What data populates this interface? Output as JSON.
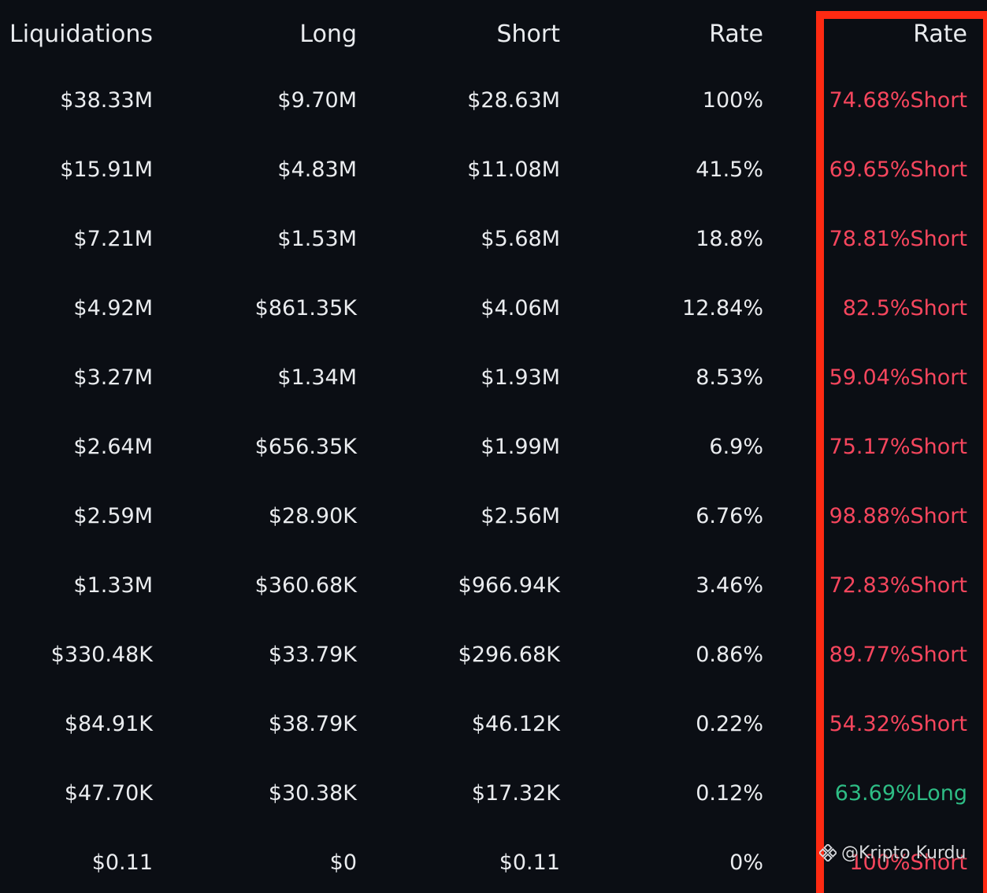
{
  "table": {
    "headers": [
      "Liquidations",
      "Long",
      "Short",
      "Rate",
      "Rate"
    ],
    "rows": [
      {
        "liquidations": "$38.33M",
        "long": "$9.70M",
        "short": "$28.63M",
        "rate": "100%",
        "side_rate": "74.68%Short",
        "side": "short"
      },
      {
        "liquidations": "$15.91M",
        "long": "$4.83M",
        "short": "$11.08M",
        "rate": "41.5%",
        "side_rate": "69.65%Short",
        "side": "short"
      },
      {
        "liquidations": "$7.21M",
        "long": "$1.53M",
        "short": "$5.68M",
        "rate": "18.8%",
        "side_rate": "78.81%Short",
        "side": "short"
      },
      {
        "liquidations": "$4.92M",
        "long": "$861.35K",
        "short": "$4.06M",
        "rate": "12.84%",
        "side_rate": "82.5%Short",
        "side": "short"
      },
      {
        "liquidations": "$3.27M",
        "long": "$1.34M",
        "short": "$1.93M",
        "rate": "8.53%",
        "side_rate": "59.04%Short",
        "side": "short"
      },
      {
        "liquidations": "$2.64M",
        "long": "$656.35K",
        "short": "$1.99M",
        "rate": "6.9%",
        "side_rate": "75.17%Short",
        "side": "short"
      },
      {
        "liquidations": "$2.59M",
        "long": "$28.90K",
        "short": "$2.56M",
        "rate": "6.76%",
        "side_rate": "98.88%Short",
        "side": "short"
      },
      {
        "liquidations": "$1.33M",
        "long": "$360.68K",
        "short": "$966.94K",
        "rate": "3.46%",
        "side_rate": "72.83%Short",
        "side": "short"
      },
      {
        "liquidations": "$330.48K",
        "long": "$33.79K",
        "short": "$296.68K",
        "rate": "0.86%",
        "side_rate": "89.77%Short",
        "side": "short"
      },
      {
        "liquidations": "$84.91K",
        "long": "$38.79K",
        "short": "$46.12K",
        "rate": "0.22%",
        "side_rate": "54.32%Short",
        "side": "short"
      },
      {
        "liquidations": "$47.70K",
        "long": "$30.38K",
        "short": "$17.32K",
        "rate": "0.12%",
        "side_rate": "63.69%Long",
        "side": "long"
      },
      {
        "liquidations": "$0.11",
        "long": "$0",
        "short": "$0.11",
        "rate": "0%",
        "side_rate": "100%Short",
        "side": "short"
      }
    ]
  },
  "colors": {
    "background": "#0b0e14",
    "text": "#eaecef",
    "short": "#f6465d",
    "long": "#2ebd85",
    "highlight_border": "#ff2a12"
  },
  "watermark": {
    "text": "@Kripto Kurdu",
    "icon": "binance-logo-icon"
  }
}
